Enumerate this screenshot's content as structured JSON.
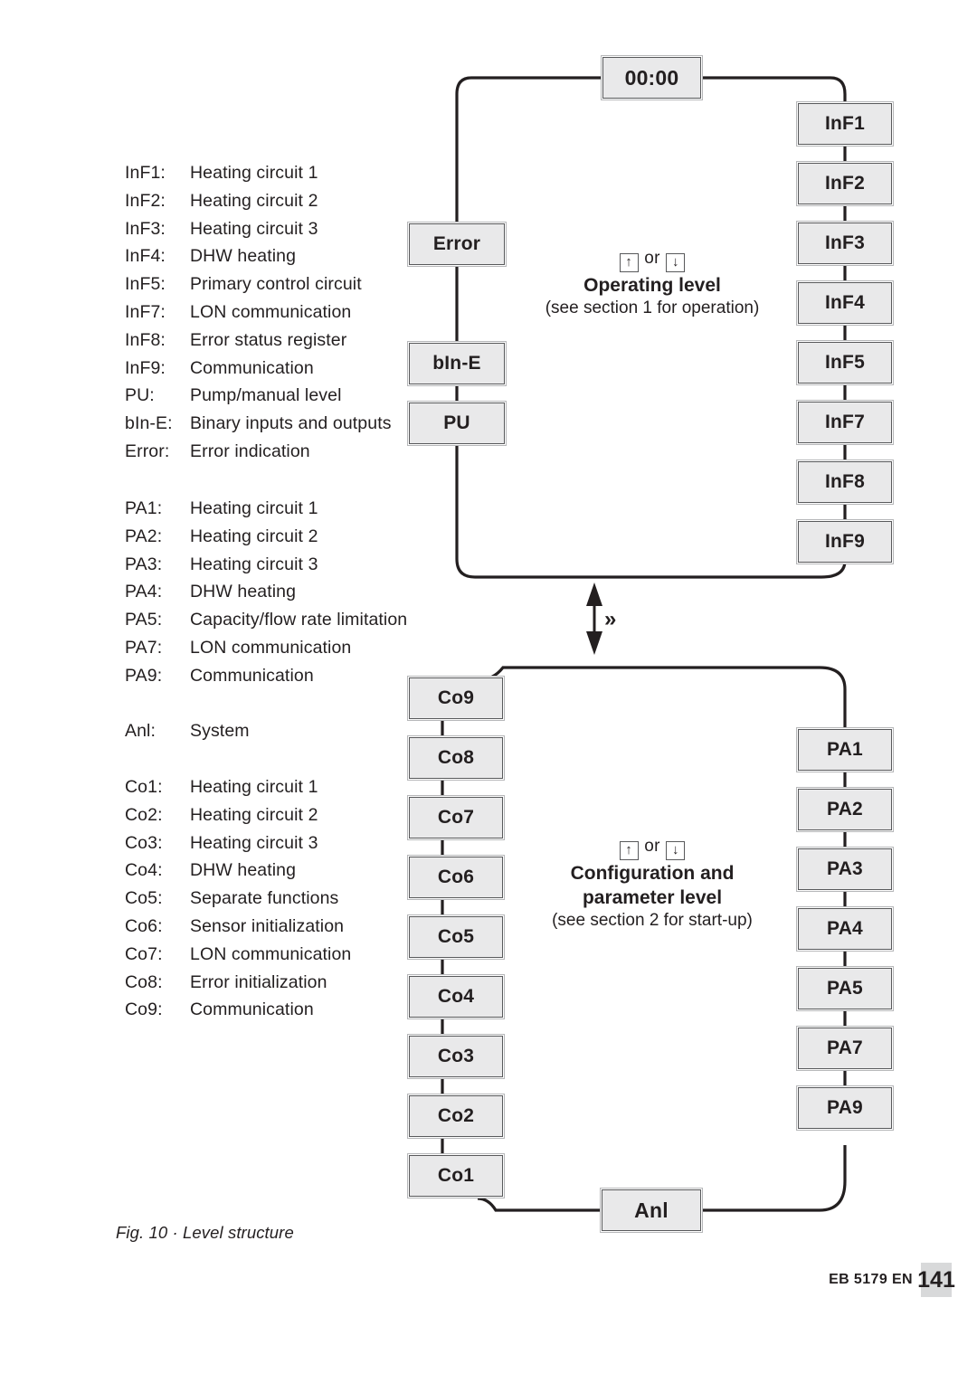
{
  "figure": {
    "caption": "Fig. 10 · Level structure",
    "doc_code": "EB 5179 EN",
    "page_number": "141"
  },
  "legend": {
    "operating": [
      {
        "key": "InF1:",
        "desc": "Heating circuit 1"
      },
      {
        "key": "InF2:",
        "desc": "Heating circuit 2"
      },
      {
        "key": "InF3:",
        "desc": "Heating circuit 3"
      },
      {
        "key": "InF4:",
        "desc": "DHW heating"
      },
      {
        "key": "InF5:",
        "desc": "Primary control circuit"
      },
      {
        "key": "InF7:",
        "desc": "LON communication"
      },
      {
        "key": "InF8:",
        "desc": "Error status register"
      },
      {
        "key": "InF9:",
        "desc": "Communication"
      },
      {
        "key": "PU:",
        "desc": "Pump/manual level"
      },
      {
        "key": "bIn-E:",
        "desc": "Binary inputs and outputs"
      },
      {
        "key": "Error:",
        "desc": "Error indication"
      }
    ],
    "parameter": [
      {
        "key": "PA1:",
        "desc": "Heating circuit 1"
      },
      {
        "key": "PA2:",
        "desc": "Heating circuit 2"
      },
      {
        "key": "PA3:",
        "desc": "Heating circuit 3"
      },
      {
        "key": "PA4:",
        "desc": "DHW heating"
      },
      {
        "key": "PA5:",
        "desc": "Capacity/flow rate limitation"
      },
      {
        "key": "PA7:",
        "desc": "LON communication"
      },
      {
        "key": "PA9:",
        "desc": "Communication"
      }
    ],
    "system": [
      {
        "key": "Anl:",
        "desc": "System"
      }
    ],
    "configuration": [
      {
        "key": "Co1:",
        "desc": "Heating circuit 1"
      },
      {
        "key": "Co2:",
        "desc": "Heating circuit 2"
      },
      {
        "key": "Co3:",
        "desc": "Heating circuit 3"
      },
      {
        "key": "Co4:",
        "desc": "DHW heating"
      },
      {
        "key": "Co5:",
        "desc": "Separate functions"
      },
      {
        "key": "Co6:",
        "desc": "Sensor initialization"
      },
      {
        "key": "Co7:",
        "desc": "LON communication"
      },
      {
        "key": "Co8:",
        "desc": "Error initialization"
      },
      {
        "key": "Co9:",
        "desc": "Communication"
      }
    ]
  },
  "diagram": {
    "operating_level": {
      "start_node": "00:00",
      "caption": {
        "keys_prefix": "",
        "key_up": "↑",
        "key_or": "or",
        "key_down": "↓",
        "title": "Operating level",
        "sub": "(see section 1 for operation)"
      },
      "right_column": [
        "InF1",
        "InF2",
        "InF3",
        "InF4",
        "InF5",
        "InF7",
        "InF8",
        "InF9"
      ],
      "left_column": [
        "Error",
        "bIn-E",
        "PU"
      ]
    },
    "transition": {
      "key_symbol": "»"
    },
    "config_level": {
      "caption": {
        "key_up": "↑",
        "key_or": "or",
        "key_down": "↓",
        "title_line1": "Configuration and",
        "title_line2": "parameter level",
        "sub": "(see section 2 for start-up)"
      },
      "left_column": [
        "Co9",
        "Co8",
        "Co7",
        "Co6",
        "Co5",
        "Co4",
        "Co3",
        "Co2",
        "Co1"
      ],
      "right_column": [
        "PA1",
        "PA2",
        "PA3",
        "PA4",
        "PA5",
        "PA7",
        "PA9"
      ],
      "bottom_node": "Anl"
    }
  },
  "colors": {
    "node_fill": "#e9e9ea",
    "node_border": "#58595b",
    "line": "#231f20",
    "page_badge": "#d8d9da"
  }
}
